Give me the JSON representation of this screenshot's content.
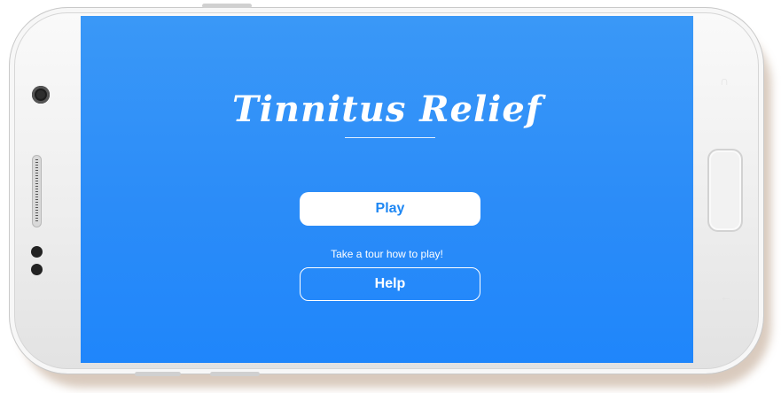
{
  "app": {
    "title": "Tinnitus Relief",
    "play_label": "Play",
    "tour_prompt": "Take a tour how to play!",
    "help_label": "Help"
  },
  "colors": {
    "screen_background": "#2b8cf8",
    "accent_text": "#1e87f3",
    "primary_button_background": "#ffffff",
    "text": "#ffffff"
  },
  "device": {
    "frame": "white-android-phone-landscape"
  }
}
